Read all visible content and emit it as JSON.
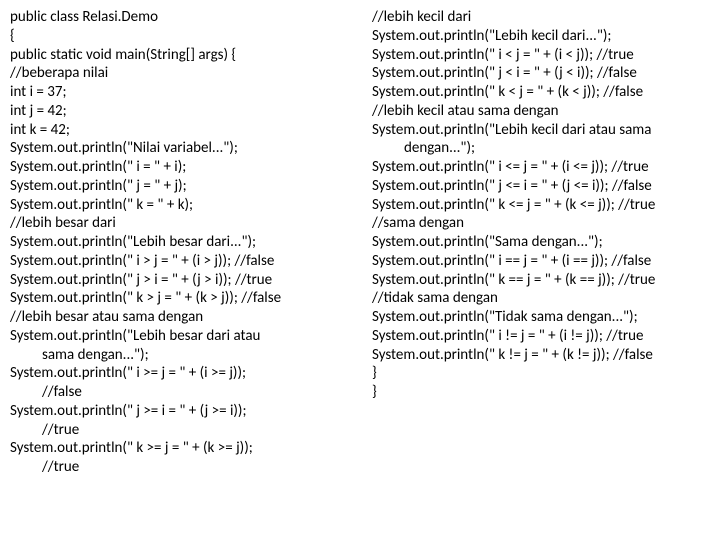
{
  "left": {
    "l01": "public class Relasi.Demo",
    "l02": "{",
    "l03": "public static void main(String[] args) {",
    "l04": "//beberapa nilai",
    "l05": "int i = 37;",
    "l06": "int j = 42;",
    "l07": "int k = 42;",
    "l08": "System.out.println(\"Nilai variabel...\");",
    "l09": "System.out.println(\" i = \" + i);",
    "l10": "System.out.println(\" j = \" + j);",
    "l11": "System.out.println(\" k = \" + k);",
    "l12": "//lebih besar dari",
    "l13": "System.out.println(\"Lebih besar dari...\");",
    "l14": "System.out.println(\" i > j = \" + (i > j)); //false",
    "l15": "System.out.println(\" j > i = \" + (j > i)); //true",
    "l16": "System.out.println(\" k > j = \" + (k > j)); //false",
    "l17": "//lebih besar atau sama dengan",
    "l18a": "System.out.println(\"Lebih besar dari atau",
    "l18b": "sama dengan...\");",
    "l19a": "System.out.println(\" i >= j = \" + (i >= j));",
    "l19b": "//false",
    "l20a": "System.out.println(\" j >= i = \" + (j >= i));",
    "l20b": "//true",
    "l21a": "System.out.println(\" k >= j = \" + (k >= j));",
    "l21b": "//true"
  },
  "right": {
    "r01": "//lebih kecil dari",
    "r02": "System.out.println(\"Lebih kecil dari...\");",
    "r03": "System.out.println(\" i < j = \" + (i < j)); //true",
    "r04": "System.out.println(\" j < i = \" + (j < i)); //false",
    "r05": "System.out.println(\" k < j = \" + (k < j)); //false",
    "r06": "//lebih kecil atau sama dengan",
    "r07a": "System.out.println(\"Lebih kecil dari atau sama",
    "r07b": "dengan...\");",
    "r08": "System.out.println(\" i <= j = \" + (i <= j)); //true",
    "r09": "System.out.println(\" j <= i = \" + (j <= i)); //false",
    "r10": "System.out.println(\" k <= j = \" + (k <= j)); //true",
    "r11": "//sama dengan",
    "r12": "System.out.println(\"Sama dengan...\");",
    "r13": "System.out.println(\" i == j = \" + (i == j)); //false",
    "r14": "System.out.println(\" k == j = \" + (k == j)); //true",
    "r15": "//tidak sama dengan",
    "r16": "System.out.println(\"Tidak sama dengan...\");",
    "r17": "System.out.println(\" i != j = \" + (i != j)); //true",
    "r18": "System.out.println(\" k != j = \" + (k != j)); //false",
    "r19": "}",
    "r20": "}"
  }
}
